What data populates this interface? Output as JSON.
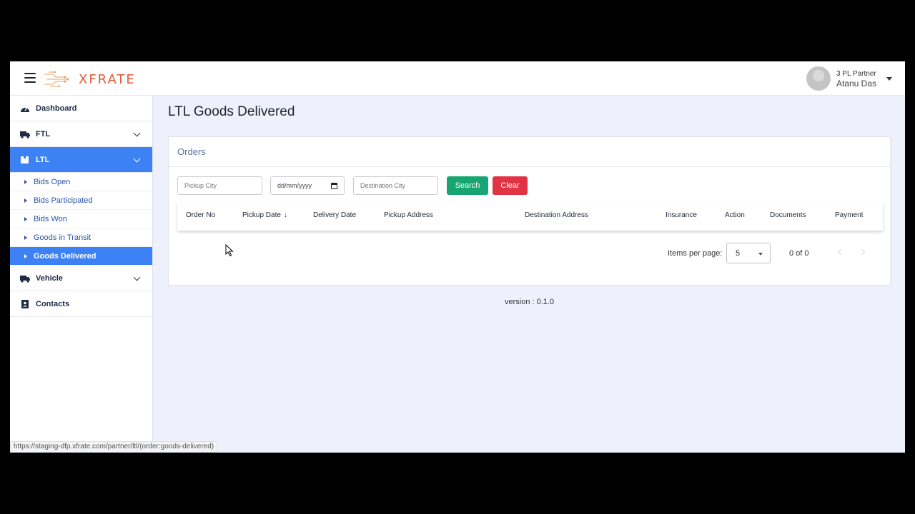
{
  "header": {
    "logo_text": "XFRATE",
    "user_role": "3 PL Partner",
    "user_name": "Atanu Das",
    "brand_color": "#e05a3a"
  },
  "sidebar": {
    "items": [
      {
        "label": "Dashboard",
        "icon": "gauge-icon"
      },
      {
        "label": "FTL",
        "icon": "truck-icon"
      },
      {
        "label": "LTL",
        "icon": "box-icon"
      },
      {
        "label": "Vehicle",
        "icon": "truck-icon"
      },
      {
        "label": "Contacts",
        "icon": "contact-book-icon"
      }
    ],
    "ltl_sub": [
      "Bids Open",
      "Bids Participated",
      "Bids Won",
      "Goods in Transit",
      "Goods Delivered"
    ],
    "active_color": "#3d82f5"
  },
  "page": {
    "title": "LTL Goods Delivered",
    "card_title": "Orders"
  },
  "filters": {
    "pickup_placeholder": "Pickup City",
    "date_placeholder": "dd/mm/yyyy",
    "destination_placeholder": "Destination City",
    "search_label": "Search",
    "clear_label": "Clear",
    "search_color": "#17a673",
    "clear_color": "#e03444"
  },
  "table": {
    "columns": [
      "Order No",
      "Pickup Date",
      "Delivery Date",
      "Pickup Address",
      "Destination Address",
      "Insurance",
      "Action",
      "Documents",
      "Payment"
    ],
    "sort_indicator": "↓",
    "rows": []
  },
  "paginator": {
    "label": "Items per page:",
    "page_size": "5",
    "range": "0 of 0"
  },
  "footer": {
    "version": "version : 0.1.0"
  },
  "status_url": "https://staging-dfp.xfrate.com/partner/ltl/(order:goods-delivered)"
}
